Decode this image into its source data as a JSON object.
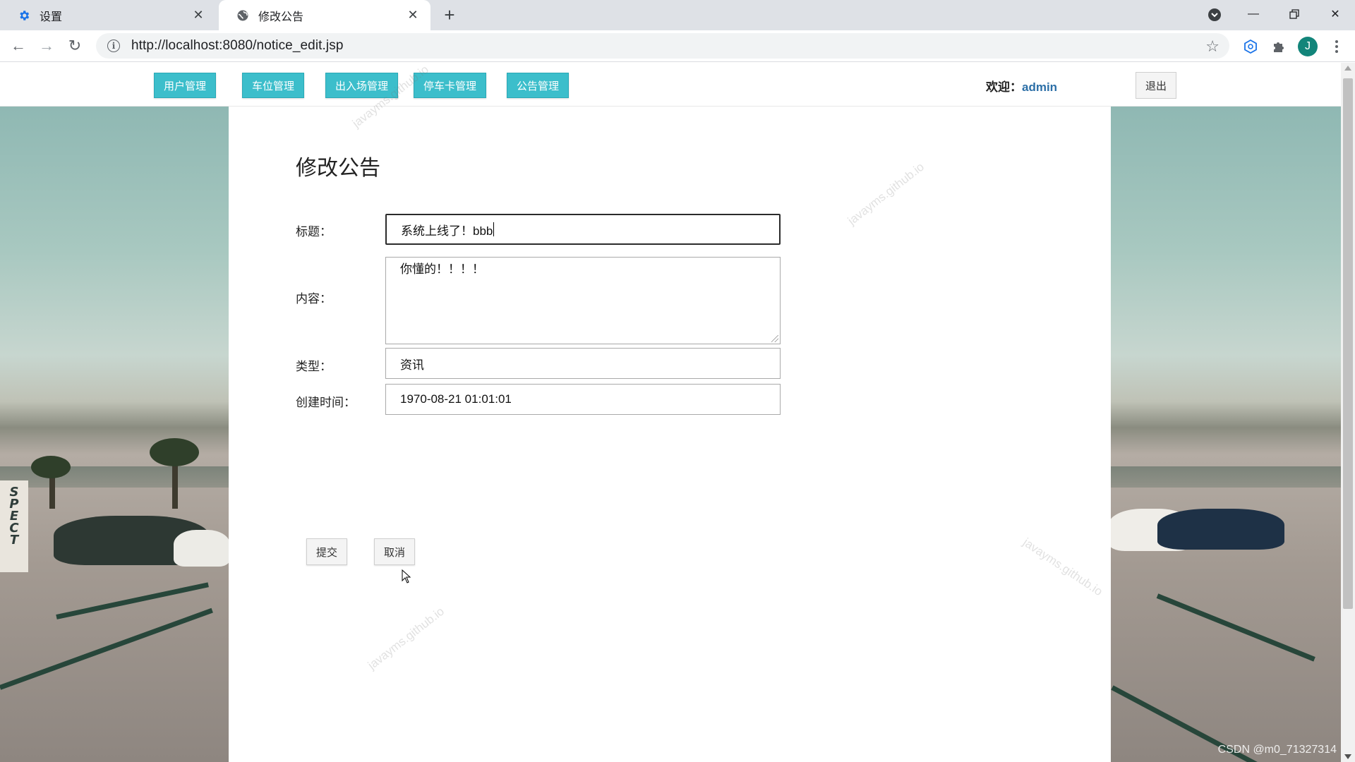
{
  "browser": {
    "tabs": [
      {
        "title": "设置",
        "icon": "gear-icon",
        "active": false
      },
      {
        "title": "修改公告",
        "icon": "globe-icon",
        "active": true
      }
    ],
    "url": "http://localhost:8080/notice_edit.jsp",
    "profile_initial": "J"
  },
  "header": {
    "nav": [
      {
        "label": "用户管理"
      },
      {
        "label": "车位管理"
      },
      {
        "label": "出入场管理"
      },
      {
        "label": "停车卡管理"
      },
      {
        "label": "公告管理"
      }
    ],
    "welcome_label": "欢迎：",
    "username": "admin",
    "logout_label": "退出"
  },
  "form": {
    "title": "修改公告",
    "fields": {
      "title_label": "标题：",
      "title_value": "系统上线了！bbb",
      "content_label": "内容：",
      "content_value": "你懂的！！！！",
      "type_label": "类型：",
      "type_value": "资讯",
      "created_label": "创建时间：",
      "created_value": "1970-08-21 01:01:01"
    },
    "submit_label": "提交",
    "cancel_label": "取消"
  },
  "background": {
    "sign_text": "SPECT"
  },
  "watermarks": [
    "javayms.github.io",
    "javayms.github.io",
    "javayms.github.io",
    "javayms.github.io"
  ],
  "corner_mark": "CSDN @m0_71327314",
  "colors": {
    "nav_button": "#3cbecb",
    "username": "#2c6fa7",
    "avatar": "#12857a"
  }
}
